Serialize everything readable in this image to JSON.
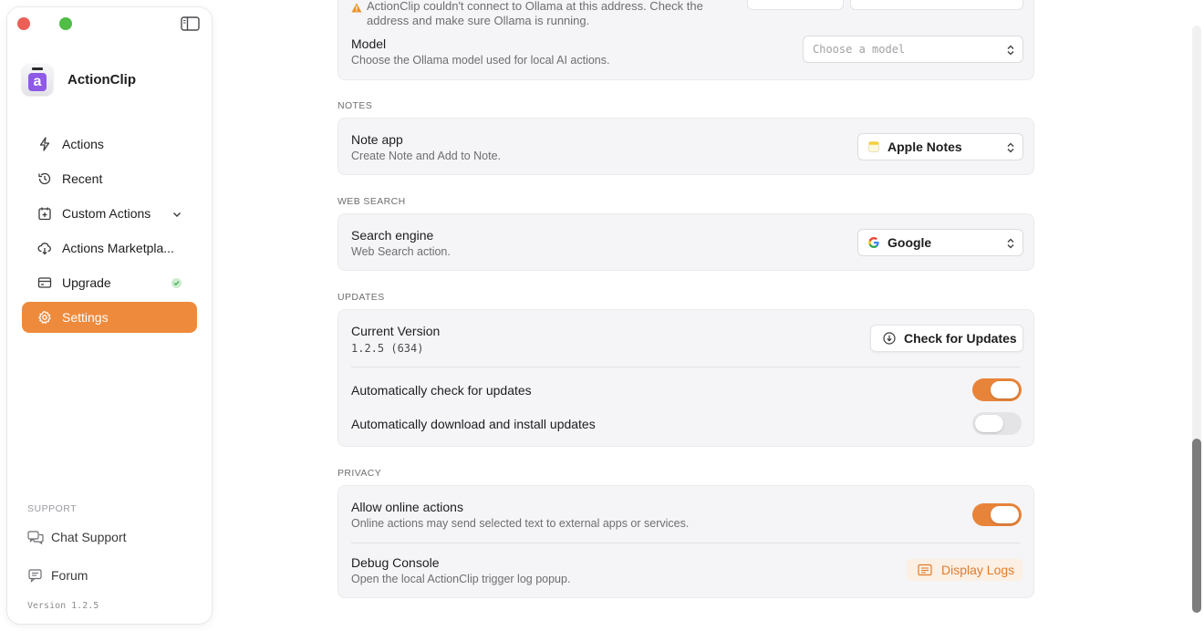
{
  "sidebar": {
    "app_name": "ActionClip",
    "app_icon_letter": "a",
    "items": [
      {
        "label": "Actions",
        "icon": "bolt-icon"
      },
      {
        "label": "Recent",
        "icon": "history-icon"
      },
      {
        "label": "Custom Actions",
        "icon": "calendar-plus-icon"
      },
      {
        "label": "Actions Marketpla...",
        "icon": "cloud-download-icon"
      },
      {
        "label": "Upgrade",
        "icon": "credit-card-icon"
      },
      {
        "label": "Settings",
        "icon": "gear-icon",
        "active": true
      }
    ],
    "support_label": "SUPPORT",
    "support_items": [
      {
        "label": "Chat Support",
        "icon": "chat-bubbles-icon"
      },
      {
        "label": "Forum",
        "icon": "message-square-icon"
      }
    ],
    "version": "Version 1.2.5"
  },
  "ollama": {
    "warning": "ActionClip couldn't connect to Ollama at this address. Check the address and make sure Ollama is running.",
    "model_title": "Model",
    "model_sub": "Choose the Ollama model used for local AI actions.",
    "model_placeholder": "Choose a model"
  },
  "notes": {
    "section": "NOTES",
    "title": "Note app",
    "sub": "Create Note and Add to Note.",
    "value": "Apple Notes"
  },
  "web_search": {
    "section": "WEB SEARCH",
    "title": "Search engine",
    "sub": "Web Search action.",
    "value": "Google"
  },
  "updates": {
    "section": "UPDATES",
    "version_title": "Current Version",
    "version_value": "1.2.5 (634)",
    "check_button": "Check for Updates",
    "auto_check_label": "Automatically check for updates",
    "auto_check_on": true,
    "auto_install_label": "Automatically download and install updates",
    "auto_install_on": false
  },
  "privacy": {
    "section": "PRIVACY",
    "online_title": "Allow online actions",
    "online_sub": "Online actions may send selected text to external apps or services.",
    "online_on": true,
    "debug_title": "Debug Console",
    "debug_sub": "Open the local ActionClip trigger log popup.",
    "debug_button": "Display Logs"
  },
  "colors": {
    "accent": "#ee8a3c",
    "toggle_on": "#e8843a",
    "warning": "#e8932a"
  }
}
